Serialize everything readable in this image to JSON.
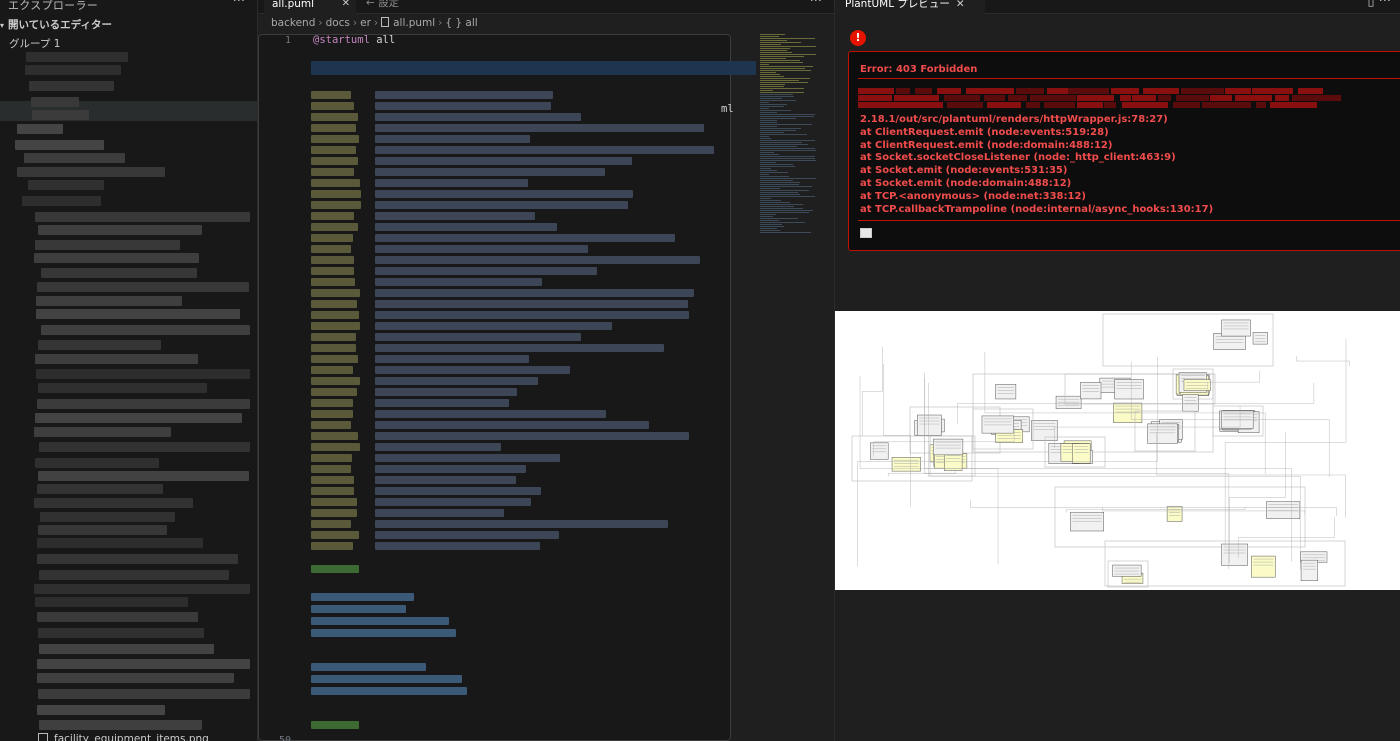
{
  "sidebar": {
    "title": "エクスプローラー",
    "more": "···",
    "open_editors": "開いているエディター",
    "group": "グループ 1",
    "bottom_file": "facility_equipment_items.png"
  },
  "editor": {
    "tabs": [
      {
        "label": "all.puml",
        "active": true
      },
      {
        "label": "設定",
        "active": false
      }
    ],
    "more": "···",
    "breadcrumb": [
      "backend",
      "docs",
      "er",
      "all.puml",
      "{ } all"
    ],
    "first_line_number": "1",
    "last_line_number": "50",
    "first_line_keyword": "@startuml",
    "first_line_text": " all",
    "visible_fragment": "ml"
  },
  "preview": {
    "tab_label": "PlantUML プレビュー",
    "badge": "!",
    "error_title": "Error: 403 Forbidden",
    "stack": [
      "2.18.1/out/src/plantuml/renders/httpWrapper.js:78:27)",
      "at ClientRequest.emit (node:events:519:28)",
      "at ClientRequest.emit (node:domain:488:12)",
      "at Socket.socketCloseListener (node:_http_client:463:9)",
      "at Socket.emit (node:events:531:35)",
      "at Socket.emit (node:domain:488:12)",
      "at TCP.<anonymous> (node:net:338:12)",
      "at TCP.callbackTrampoline (node:internal/async_hooks:130:17)"
    ]
  },
  "colors": {
    "error": "#f14c4c",
    "error_border": "#be1100",
    "accent": "#0078d4",
    "keyword": "#c586c0"
  }
}
